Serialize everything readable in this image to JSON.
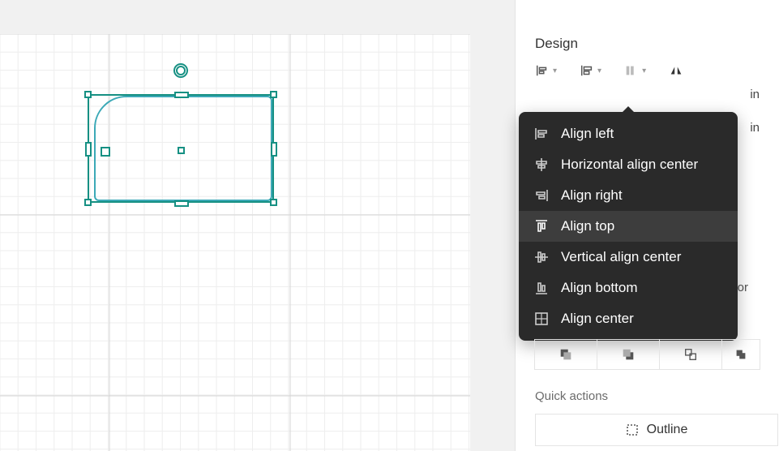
{
  "panel": {
    "title": "Design",
    "quick_actions_label": "Quick actions",
    "outline_label": "Outline",
    "unit1": "in",
    "unit2": "in",
    "hidden_suffix": "or"
  },
  "menu": {
    "items": [
      {
        "label": "Align left",
        "icon": "align-left"
      },
      {
        "label": "Horizontal align center",
        "icon": "h-center"
      },
      {
        "label": "Align right",
        "icon": "align-right"
      },
      {
        "label": "Align top",
        "icon": "align-top",
        "hover": true
      },
      {
        "label": "Vertical align center",
        "icon": "v-center"
      },
      {
        "label": "Align bottom",
        "icon": "align-bottom"
      },
      {
        "label": "Align center",
        "icon": "align-center"
      }
    ]
  }
}
